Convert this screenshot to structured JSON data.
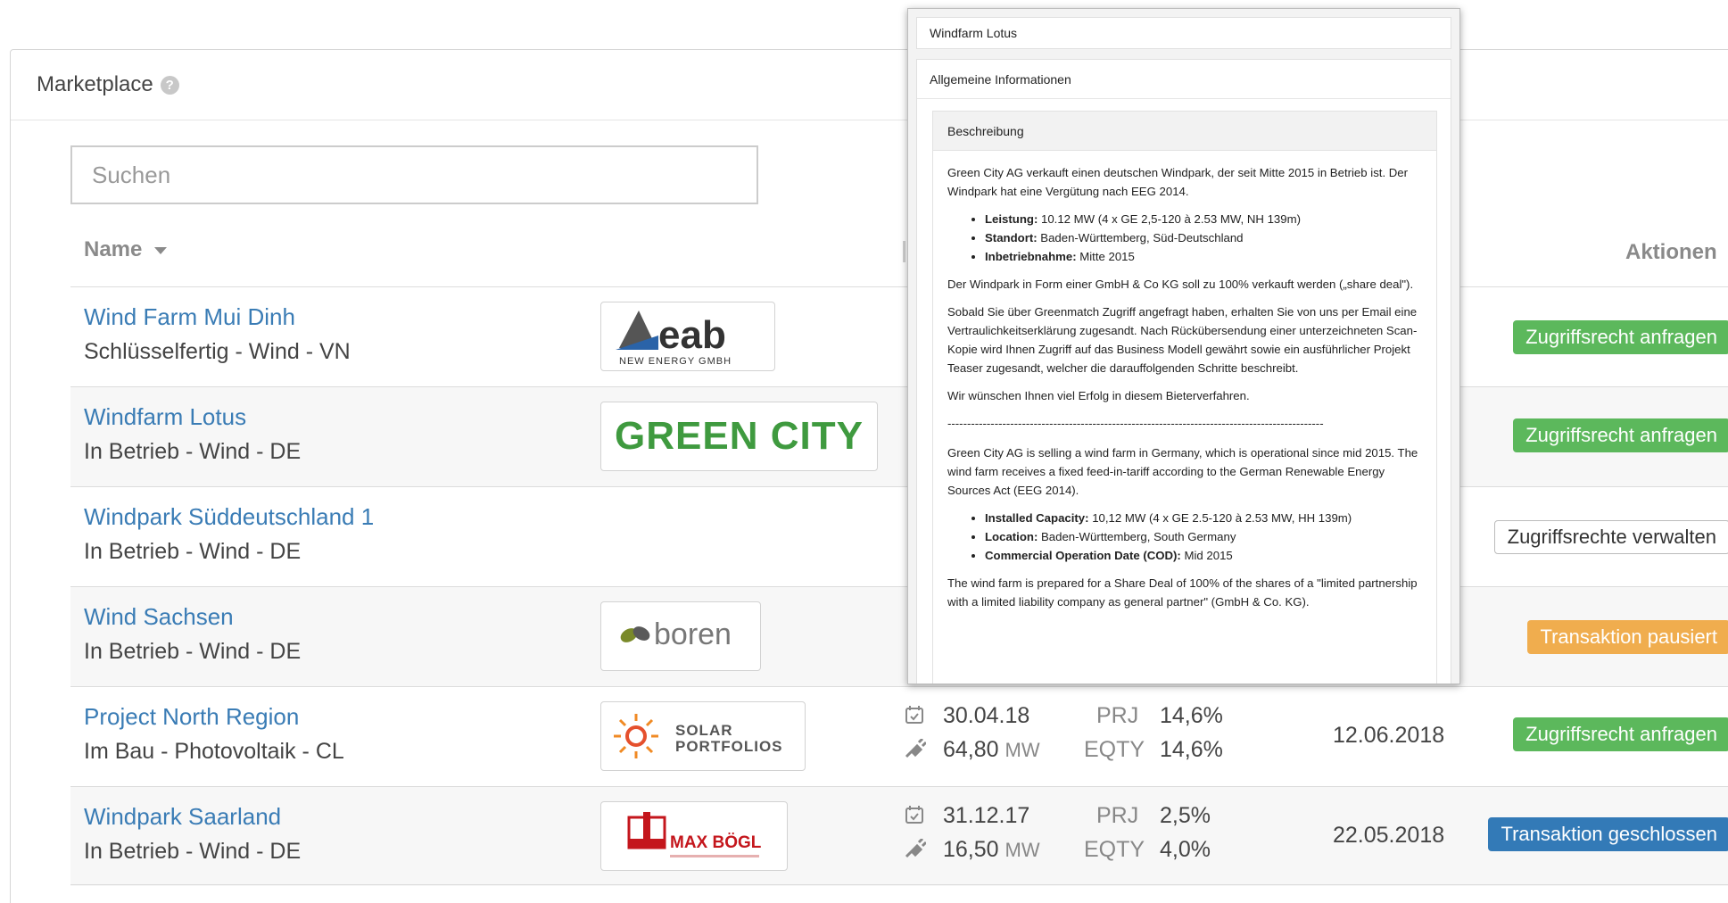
{
  "panel": {
    "title": "Marketplace",
    "help_glyph": "?"
  },
  "search": {
    "placeholder": "Suchen"
  },
  "table": {
    "col_name": "Name",
    "col_actions": "Aktionen",
    "rows": [
      {
        "name": "Wind Farm Mui Dinh",
        "sub": "Schlüsselfertig - Wind - VN",
        "logo_text": "eab",
        "logo_sub": "NEW ENERGY GMBH",
        "action": "Zugriffsrecht anfragen"
      },
      {
        "name": "Windfarm Lotus",
        "sub": "In Betrieb - Wind - DE",
        "logo_text": "GREEN CITY",
        "action": "Zugriffsrecht anfragen"
      },
      {
        "name": "Windpark Süddeutschland 1",
        "sub": "In Betrieb - Wind - DE",
        "action": "Zugriffsrechte verwalten"
      },
      {
        "name": "Wind Sachsen",
        "sub": "In Betrieb - Wind - DE",
        "logo_text": "boren",
        "action": "Transaktion pausiert"
      },
      {
        "name": "Project North Region",
        "sub": "Im Bau - Photovoltaik - CL",
        "logo_text": "SOLAR",
        "logo_text2": "PORTFOLIOS",
        "action": "Zugriffsrecht anfragen",
        "date1": "30.04.18",
        "power": "64,80",
        "unit": "MW",
        "prj_label": "PRJ",
        "prj": "14,6%",
        "eqty_label": "EQTY",
        "eqty": "14,6%",
        "date": "12.06.2018"
      },
      {
        "name": "Windpark Saarland",
        "sub": "In Betrieb - Wind - DE",
        "logo_text": "MAX BÖGL",
        "action": "Transaktion geschlossen",
        "date1": "31.12.17",
        "power": "16,50",
        "unit": "MW",
        "prj_label": "PRJ",
        "prj": "2,5%",
        "eqty_label": "EQTY",
        "eqty": "4,0%",
        "date": "22.05.2018"
      }
    ]
  },
  "popover": {
    "title": "Windfarm Lotus",
    "section": "Allgemeine Informationen",
    "desc_head": "Beschreibung",
    "p1": "Green City AG verkauft einen deutschen Windpark, der seit Mitte 2015 in Betrieb ist. Der Windpark hat eine Vergütung nach EEG 2014.",
    "b1_label": "Leistung:",
    "b1_value": " 10.12 MW (4 x GE 2,5-120 à 2.53 MW, NH 139m)",
    "b2_label": "Standort:",
    "b2_value": " Baden-Württemberg, Süd-Deutschland",
    "b3_label": "Inbetriebnahme:",
    "b3_value": " Mitte 2015",
    "p2": "Der Windpark in Form einer GmbH & Co KG soll zu 100% verkauft werden („share deal\").",
    "p3": "Sobald Sie über Greenmatch Zugriff angefragt haben, erhalten Sie von uns per Email eine Vertraulichkeitserklärung zugesandt. Nach Rückübersendung einer unterzeichneten Scan-Kopie wird Ihnen Zugriff auf das Business Modell gewährt sowie ein ausführlicher Projekt Teaser zugesandt, welcher die darauffolgenden Schritte beschreibt.",
    "p4": "Wir wünschen Ihnen viel Erfolg in diesem Bieterverfahren.",
    "divider": "------------------------------------------------------------------------------------------------",
    "p5": "Green City AG is selling a wind farm in Germany, which is operational since mid 2015. The wind farm receives a fixed feed-in-tariff according to the German Renewable Energy Sources Act (EEG 2014).",
    "e1_label": "Installed Capacity:",
    "e1_value": " 10,12 MW (4 x GE 2.5-120 à 2.53 MW, HH 139m)",
    "e2_label": "Location:",
    "e2_value": " Baden-Württemberg, South Germany",
    "e3_label": "Commercial Operation Date (COD):",
    "e3_value": " Mid 2015",
    "p6": "The wind farm is prepared for a Share Deal of 100% of the shares of a \"limited partnership with a limited liability company as general partner\" (GmbH & Co. KG)."
  },
  "colors": {
    "link": "#3a7cb5",
    "green": "#5cb85c",
    "orange": "#f0ad4e",
    "blue": "#337ab7"
  },
  "icons": {
    "calendar": "calendar-check-icon",
    "plug": "plug-icon"
  }
}
